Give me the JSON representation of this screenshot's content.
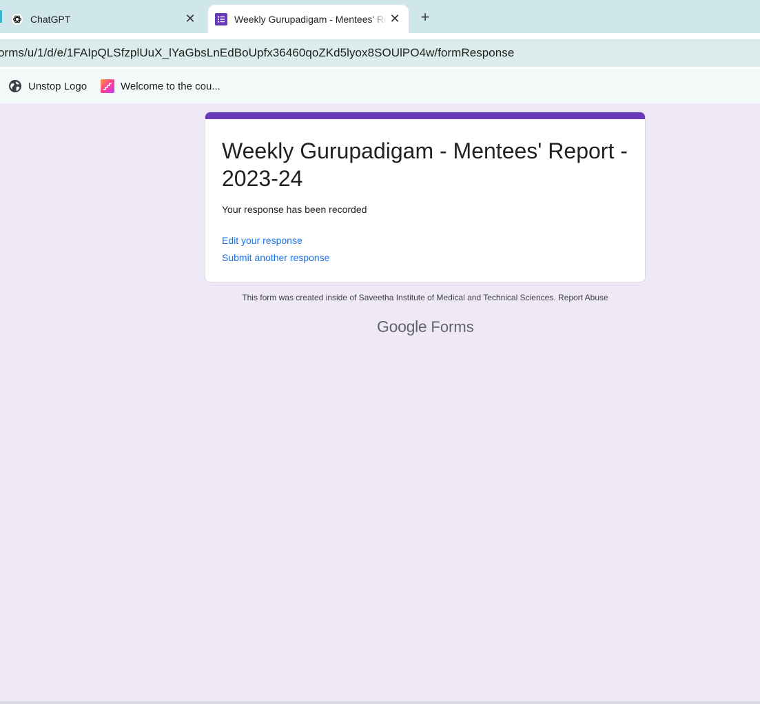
{
  "tabs": [
    {
      "title": "ChatGPT",
      "icon": "chatgpt-icon",
      "active": false
    },
    {
      "title": "Weekly Gurupadigam - Mentees' Report - 2023-24",
      "icon": "google-forms-icon",
      "active": true
    }
  ],
  "new_tab_symbol": "+",
  "close_symbol": "✕",
  "address": {
    "url": "orms/u/1/d/e/1FAIpQLSfzplUuX_lYaGbsLnEdBoUpfx36460qoZKd5lyox8SOUlPO4w/formResponse"
  },
  "bookmarks": [
    {
      "label": "Unstop Logo",
      "icon": "globe-icon"
    },
    {
      "label": "Welcome to the cou...",
      "icon": "stairs-icon"
    }
  ],
  "form": {
    "title": "Weekly Gurupadigam - Mentees' Report - 2023-24",
    "confirmation": "Your response has been recorded",
    "edit_link": "Edit your response",
    "another_link": "Submit another response",
    "footer_text": "This form was created inside of Saveetha Institute of Medical and Technical Sciences.",
    "report_abuse": "Report Abuse",
    "brand_google": "Google",
    "brand_forms": "Forms"
  },
  "colors": {
    "form_accent": "#673ab7",
    "link": "#1a73e8",
    "page_background": "#efe9f7"
  }
}
